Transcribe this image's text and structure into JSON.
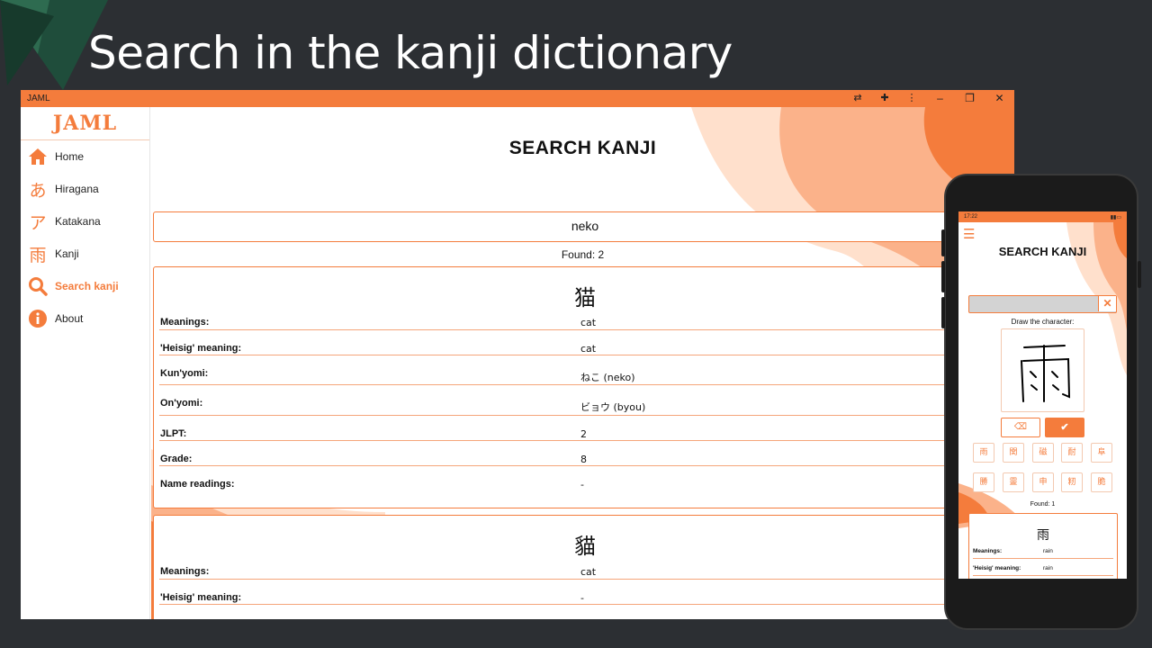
{
  "slide": {
    "title": "Search in the kanji dictionary"
  },
  "window": {
    "app_name": "JAML",
    "toolbar_icons": [
      "translate-icon",
      "puzzle-icon",
      "more-vert-icon"
    ],
    "controls": {
      "minimize": "–",
      "maximize": "❐",
      "close": "✕"
    }
  },
  "sidebar": {
    "brand": "JAML",
    "items": [
      {
        "label": "Home",
        "icon": "⌂",
        "active": false
      },
      {
        "label": "Hiragana",
        "icon": "あ",
        "active": false
      },
      {
        "label": "Katakana",
        "icon": "ア",
        "active": false
      },
      {
        "label": "Kanji",
        "icon": "雨",
        "active": false
      },
      {
        "label": "Search kanji",
        "icon": "search",
        "active": true
      },
      {
        "label": "About",
        "icon": "i",
        "active": false
      }
    ]
  },
  "main": {
    "title": "SEARCH KANJI",
    "search_value": "neko",
    "found": "Found: 2",
    "cards": [
      {
        "kanji": "猫",
        "rows": [
          {
            "label": "Meanings:",
            "value": "cat"
          },
          {
            "label": "'Heisig' meaning:",
            "value": "cat"
          },
          {
            "label": "Kun'yomi:",
            "value": "ねこ (neko)"
          },
          {
            "label": "On'yomi:",
            "value": "ビョウ (byou)"
          },
          {
            "label": "JLPT:",
            "value": "2"
          },
          {
            "label": "Grade:",
            "value": "8"
          },
          {
            "label": "Name readings:",
            "value": "-"
          }
        ]
      },
      {
        "kanji": "貓",
        "rows": [
          {
            "label": "Meanings:",
            "value": "cat"
          },
          {
            "label": "'Heisig' meaning:",
            "value": "-"
          }
        ]
      }
    ]
  },
  "phone": {
    "status_time": "17:22",
    "title": "SEARCH KANJI",
    "clear_label": "✕",
    "draw_label": "Draw the character:",
    "drawn_char": "雨",
    "erase_label": "⌫",
    "ok_label": "✔",
    "candidates": [
      "雨",
      "関",
      "磁",
      "耐",
      "阜",
      "勝",
      "靈",
      "申",
      "籾",
      "脆"
    ],
    "found": "Found: 1",
    "card": {
      "kanji": "雨",
      "rows": [
        {
          "label": "Meanings:",
          "value": "rain"
        },
        {
          "label": "'Heisig' meaning:",
          "value": "rain"
        }
      ]
    }
  },
  "colors": {
    "accent": "#f47c3c",
    "accent_light": "#ffd9c2",
    "background": "#2c2f33"
  }
}
